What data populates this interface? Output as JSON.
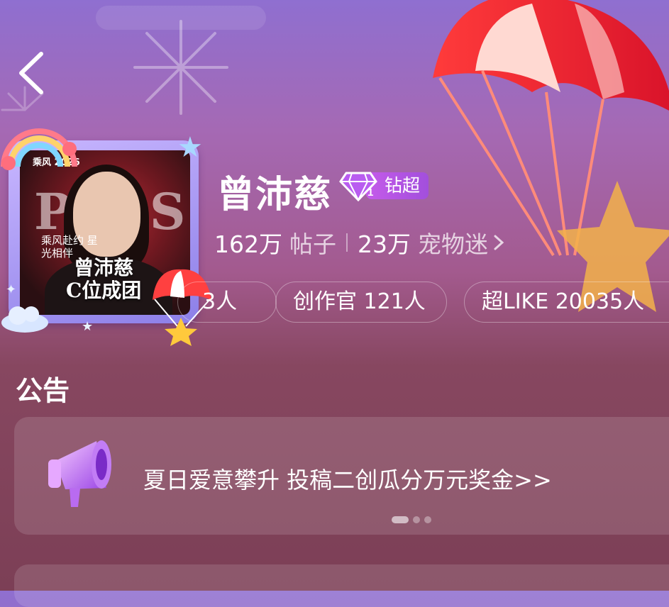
{
  "header": {
    "back_icon": "chevron-left-icon"
  },
  "forum": {
    "name": "曾沛慈",
    "level_badge": "钻超",
    "gem_level": "1"
  },
  "stats": {
    "posts_value": "162万",
    "posts_label": "帖子",
    "fans_value": "23万",
    "fans_label": "宠物迷",
    "more_icon": "chevron-right-icon"
  },
  "chips": [
    {
      "label": "3人"
    },
    {
      "label": "创作官 121人"
    },
    {
      "label": "超LIKE 20035人"
    }
  ],
  "avatar": {
    "brand": "乘风 2026",
    "headline": "PASS",
    "side_caption": "乘风赴约 星光相伴",
    "caption_line1": "曾沛慈",
    "caption_line2": "C位成团"
  },
  "announcement": {
    "title": "公告",
    "text": "夏日爱意攀升 投稿二创瓜分万元奖金>>",
    "icon": "megaphone-icon",
    "pages": 3,
    "active_page": 1
  },
  "colors": {
    "accent_purple": "#b455e6",
    "bg_top": "#8f6fd0",
    "bg_bottom": "#7c3f56"
  }
}
